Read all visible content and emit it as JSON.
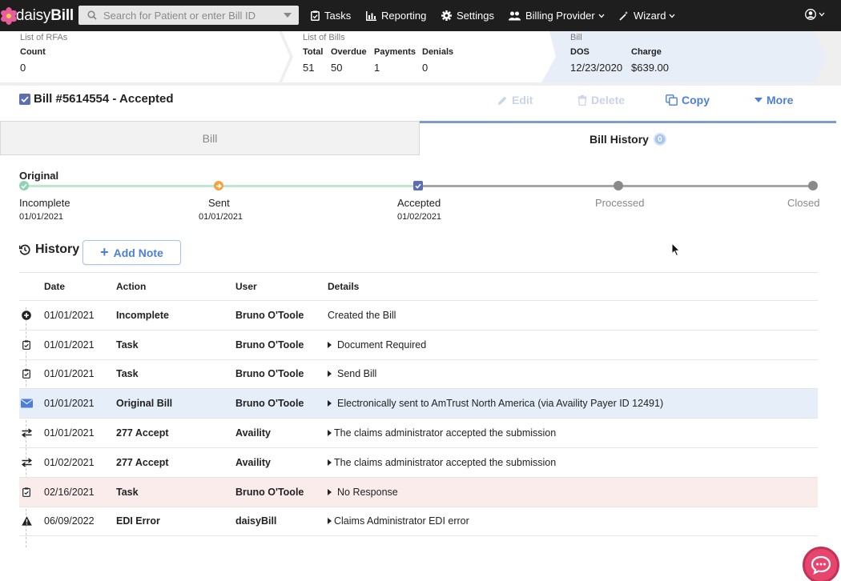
{
  "app": {
    "logo_text_light": "daisy",
    "logo_text_bold": "Bill"
  },
  "search": {
    "placeholder": "Search for Patient or enter Bill ID"
  },
  "nav": {
    "tasks": "Tasks",
    "reporting": "Reporting",
    "settings": "Settings",
    "billing_provider": "Billing Provider",
    "wizard": "Wizard"
  },
  "breadcrumbs": {
    "rfas": {
      "title": "List of RFAs",
      "count_label": "Count",
      "count_value": "0"
    },
    "bills": {
      "title": "List of Bills",
      "total_label": "Total",
      "total_value": "51",
      "overdue_label": "Overdue",
      "overdue_value": "50",
      "payments_label": "Payments",
      "payments_value": "1",
      "denials_label": "Denials",
      "denials_value": "0"
    },
    "bill": {
      "title": "Bill",
      "dos_label": "DOS",
      "dos_value": "12/23/2020",
      "charge_label": "Charge",
      "charge_value": "$639.00"
    }
  },
  "bill_header": {
    "title": "Bill #5614554 - Accepted",
    "edit": "Edit",
    "delete": "Delete",
    "copy": "Copy",
    "more": "More"
  },
  "tabs": {
    "bill": "Bill",
    "history": "Bill History",
    "history_badge": "0"
  },
  "status_track": {
    "title": "Original",
    "stages": [
      {
        "label": "Incomplete",
        "date": "01/01/2021"
      },
      {
        "label": "Sent",
        "date": "01/01/2021"
      },
      {
        "label": "Accepted",
        "date": "01/02/2021"
      },
      {
        "label": "Processed",
        "date": ""
      },
      {
        "label": "Closed",
        "date": ""
      }
    ],
    "colors": {
      "done": "#8fd3b0",
      "sent": "#f0a442",
      "accepted": "#5b6db5",
      "future": "#9a9a9a"
    }
  },
  "history": {
    "title": "History",
    "add_note": "Add Note",
    "columns": {
      "date": "Date",
      "action": "Action",
      "user": "User",
      "details": "Details"
    },
    "rows": [
      {
        "icon": "plus-circle-icon",
        "date": "01/01/2021",
        "action": "Incomplete",
        "user": "Bruno O'Toole",
        "details": "Created the Bill",
        "expandable": false,
        "highlight": ""
      },
      {
        "icon": "task-clipboard-icon",
        "date": "01/01/2021",
        "action": "Task",
        "user": "Bruno O'Toole",
        "details": "Document Required",
        "expandable": true,
        "highlight": ""
      },
      {
        "icon": "task-clipboard-icon",
        "date": "01/01/2021",
        "action": "Task",
        "user": "Bruno O'Toole",
        "details": "Send Bill",
        "expandable": true,
        "highlight": ""
      },
      {
        "icon": "envelope-icon",
        "date": "01/01/2021",
        "action": "Original Bill",
        "user": "Bruno O'Toole",
        "details": "Electronically sent to AmTrust North America (via Availity Payer ID 12491)",
        "expandable": true,
        "highlight": "blue"
      },
      {
        "icon": "exchange-arrows-icon",
        "date": "01/01/2021",
        "action": "277 Accept",
        "user": "Availity",
        "details": "The claims administrator accepted the submission",
        "expandable": true,
        "highlight": ""
      },
      {
        "icon": "exchange-arrows-icon",
        "date": "01/02/2021",
        "action": "277 Accept",
        "user": "Availity",
        "details": "The claims administrator accepted the submission",
        "expandable": true,
        "highlight": ""
      },
      {
        "icon": "task-clipboard-icon",
        "date": "02/16/2021",
        "action": "Task",
        "user": "Bruno O'Toole",
        "details": "No Response",
        "expandable": true,
        "highlight": "red"
      },
      {
        "icon": "warning-triangle-icon",
        "date": "06/09/2022",
        "action": "EDI Error",
        "user": "daisyBill",
        "details": "Claims Administrator EDI error",
        "expandable": true,
        "highlight": ""
      }
    ]
  }
}
